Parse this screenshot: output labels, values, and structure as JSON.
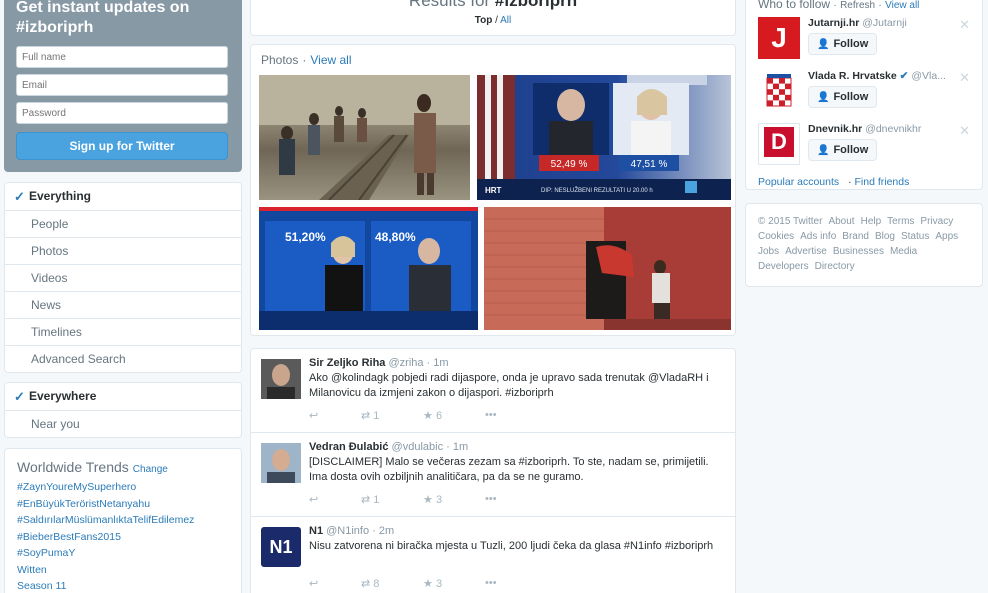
{
  "signup": {
    "title_line1": "Get instant updates on",
    "title_line2": "#izboriprh",
    "full_name_placeholder": "Full name",
    "email_placeholder": "Email",
    "password_placeholder": "Password",
    "button": "Sign up for Twitter"
  },
  "filters": {
    "type": [
      "Everything",
      "People",
      "Photos",
      "Videos",
      "News",
      "Timelines",
      "Advanced Search"
    ],
    "location": [
      "Everywhere",
      "Near you"
    ]
  },
  "trends": {
    "title": "Worldwide Trends",
    "change": "Change",
    "items": [
      "#ZaynYoureMySuperhero",
      "#EnBüyükTeröristNetanyahu",
      "#SaldırılarMüslümanlıktaTelifEdilemez",
      "#BieberBestFans2015",
      "#SoyPumaY",
      "Witten",
      "Season 11"
    ]
  },
  "results": {
    "title_prefix": "Results for",
    "query": "#izboriprh",
    "top": "Top",
    "slash": "/",
    "all": "All",
    "dots": "•••"
  },
  "photos": {
    "label": "Photos",
    "sep": "·",
    "view_all": "View all",
    "overlay": {
      "pct_left": "52,49 %",
      "pct_right": "47,51 %",
      "caption": "DIP: NESLUŽBENI REZULTATI U 20.00 h",
      "tv_left": "51,20%",
      "tv_right": "48,80%",
      "brand": "HRT"
    }
  },
  "tweets": [
    {
      "name": "Sir Zeljko Riha",
      "handle": "@zriha · 1m",
      "text": "Ako @kolindagk pobjedi radi dijaspore, onda je upravo sada trenutak @VladaRH i Milanovicu da izmjeni zakon o dijaspori. #izboriprh",
      "retweets": "1",
      "favorites": "6"
    },
    {
      "name": "Vedran Đulabić",
      "handle": "@vdulabic · 1m",
      "text": "[DISCLAIMER] Malo se večeras zezam sa #izboriprh. To ste, nadam se, primijetili. Ima dosta ovih ozbiljnih analitičara, pa da se ne guramo.",
      "retweets": "1",
      "favorites": "3"
    },
    {
      "name": "N1",
      "handle": "@N1info · 2m",
      "text": "Nisu zatvorena ni biračka mjesta u Tuzli, 200 ljudi čeka da glasa #N1info #izboriprh",
      "retweets": "8",
      "favorites": "3",
      "avatar_text": "N1"
    }
  ],
  "who_to_follow": {
    "title": "Who to follow",
    "refresh": "Refresh",
    "view_all": "View all",
    "follow_label": "Follow",
    "accounts": [
      {
        "name": "Jutarnji.hr",
        "handle": "@Jutarnji",
        "avatar_text": "J",
        "color": "#d71920"
      },
      {
        "name": "Vlada R. Hrvatske",
        "handle": "@Vla...",
        "avatar_text": "",
        "color": "#cc1f2a",
        "verified": true
      },
      {
        "name": "Dnevnik.hr",
        "handle": "@dnevnikhr",
        "avatar_text": "D",
        "color": "#c8102e"
      }
    ],
    "popular": "Popular accounts",
    "find_friends": "Find friends"
  },
  "footer": {
    "lines": [
      [
        "© 2015 Twitter",
        "About",
        "Help",
        "Terms",
        "Privacy"
      ],
      [
        "Cookies",
        "Ads info",
        "Brand",
        "Blog",
        "Status",
        "Apps"
      ],
      [
        "Jobs",
        "Advertise",
        "Businesses",
        "Media"
      ],
      [
        "Developers",
        "Directory"
      ]
    ]
  },
  "colors": {
    "accent": "#2b7bb9",
    "button": "#4aa3df",
    "signup_bg": "#8899a6"
  }
}
